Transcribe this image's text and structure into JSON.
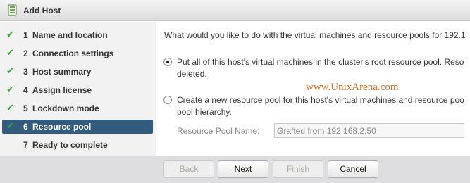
{
  "window": {
    "title": "Add Host",
    "icon": "host-add-icon"
  },
  "colors": {
    "accent": "#335b7e",
    "check": "#2ea53a",
    "watermark": "#e06a1a",
    "footer": "#dedee0",
    "sidebar": "#f2f2f2"
  },
  "steps": [
    {
      "num": "1",
      "label": "Name and location",
      "done": true,
      "active": false
    },
    {
      "num": "2",
      "label": "Connection settings",
      "done": true,
      "active": false
    },
    {
      "num": "3",
      "label": "Host summary",
      "done": true,
      "active": false
    },
    {
      "num": "4",
      "label": "Assign license",
      "done": true,
      "active": false
    },
    {
      "num": "5",
      "label": "Lockdown mode",
      "done": true,
      "active": false
    },
    {
      "num": "6",
      "label": "Resource pool",
      "done": true,
      "active": true
    },
    {
      "num": "7",
      "label": "Ready to complete",
      "done": false,
      "active": false
    }
  ],
  "content": {
    "question": "What would you like to do with the virtual machines and resource pools for 192.1",
    "option1": {
      "line1": "Put all of this host's virtual machines in the cluster's root resource pool. Reso",
      "line2": "deleted.",
      "selected": true
    },
    "option2": {
      "line1": "Create a new resource pool for this host's virtual machines and resource poo",
      "line2": "pool hierarchy.",
      "selected": false
    },
    "watermark": "www.UnixArena.com",
    "pool_name_label": "Resource Pool Name:",
    "pool_name_value": "Grafted from 192.168.2.50"
  },
  "footer": {
    "back": "Back",
    "next": "Next",
    "finish": "Finish",
    "cancel": "Cancel"
  }
}
